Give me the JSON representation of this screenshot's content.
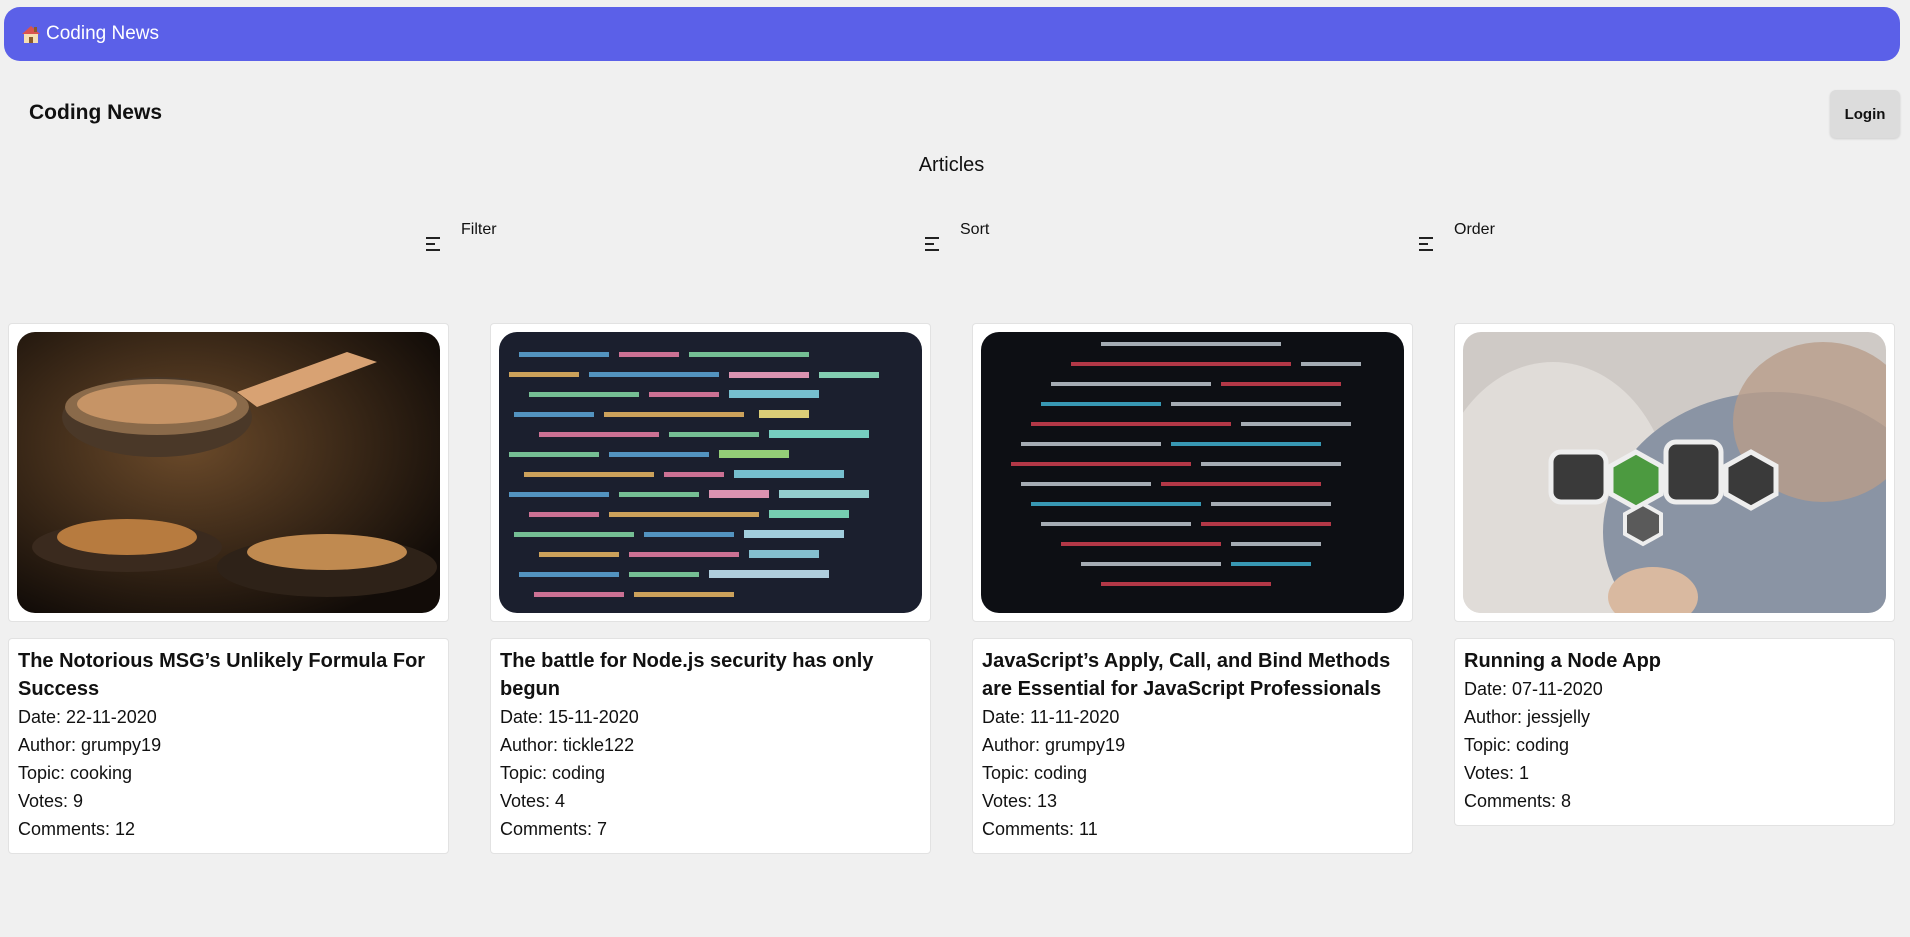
{
  "nav": {
    "brand": "Coding News",
    "home_emoji": "🏠"
  },
  "header": {
    "title": "Coding News",
    "login_label": "Login"
  },
  "main": {
    "heading": "Articles",
    "controls": {
      "filter": "Filter",
      "sort": "Sort",
      "order": "Order"
    }
  },
  "articles": [
    {
      "title": "The Notorious MSG’s Unlikely Formula For Success",
      "date": "Date: 22-11-2020",
      "author": "Author: grumpy19",
      "topic": "Topic: cooking",
      "votes": "Votes: 9",
      "comments": "Comments: 12",
      "image": "cooking-photo"
    },
    {
      "title": "The battle for Node.js security has only begun",
      "date": "Date: 15-11-2020",
      "author": "Author: tickle122",
      "topic": "Topic: coding",
      "votes": "Votes: 4",
      "comments": "Comments: 7",
      "image": "code-screen-photo"
    },
    {
      "title": "JavaScript’s Apply, Call, and Bind Methods are Essential for JavaScript Professionals",
      "date": "Date: 11-11-2020",
      "author": "Author: grumpy19",
      "topic": "Topic: coding",
      "votes": "Votes: 13",
      "comments": "Comments: 11",
      "image": "code-screen-photo"
    },
    {
      "title": "Running a Node App",
      "date": "Date: 07-11-2020",
      "author": "Author: jessjelly",
      "topic": "Topic: coding",
      "votes": "Votes: 1",
      "comments": "Comments: 8",
      "image": "nodejs-sticker-photo"
    }
  ],
  "colors": {
    "nav_bg": "#5b60e8",
    "page_bg": "#f0f0f0",
    "login_bg": "#dcdcdc"
  }
}
